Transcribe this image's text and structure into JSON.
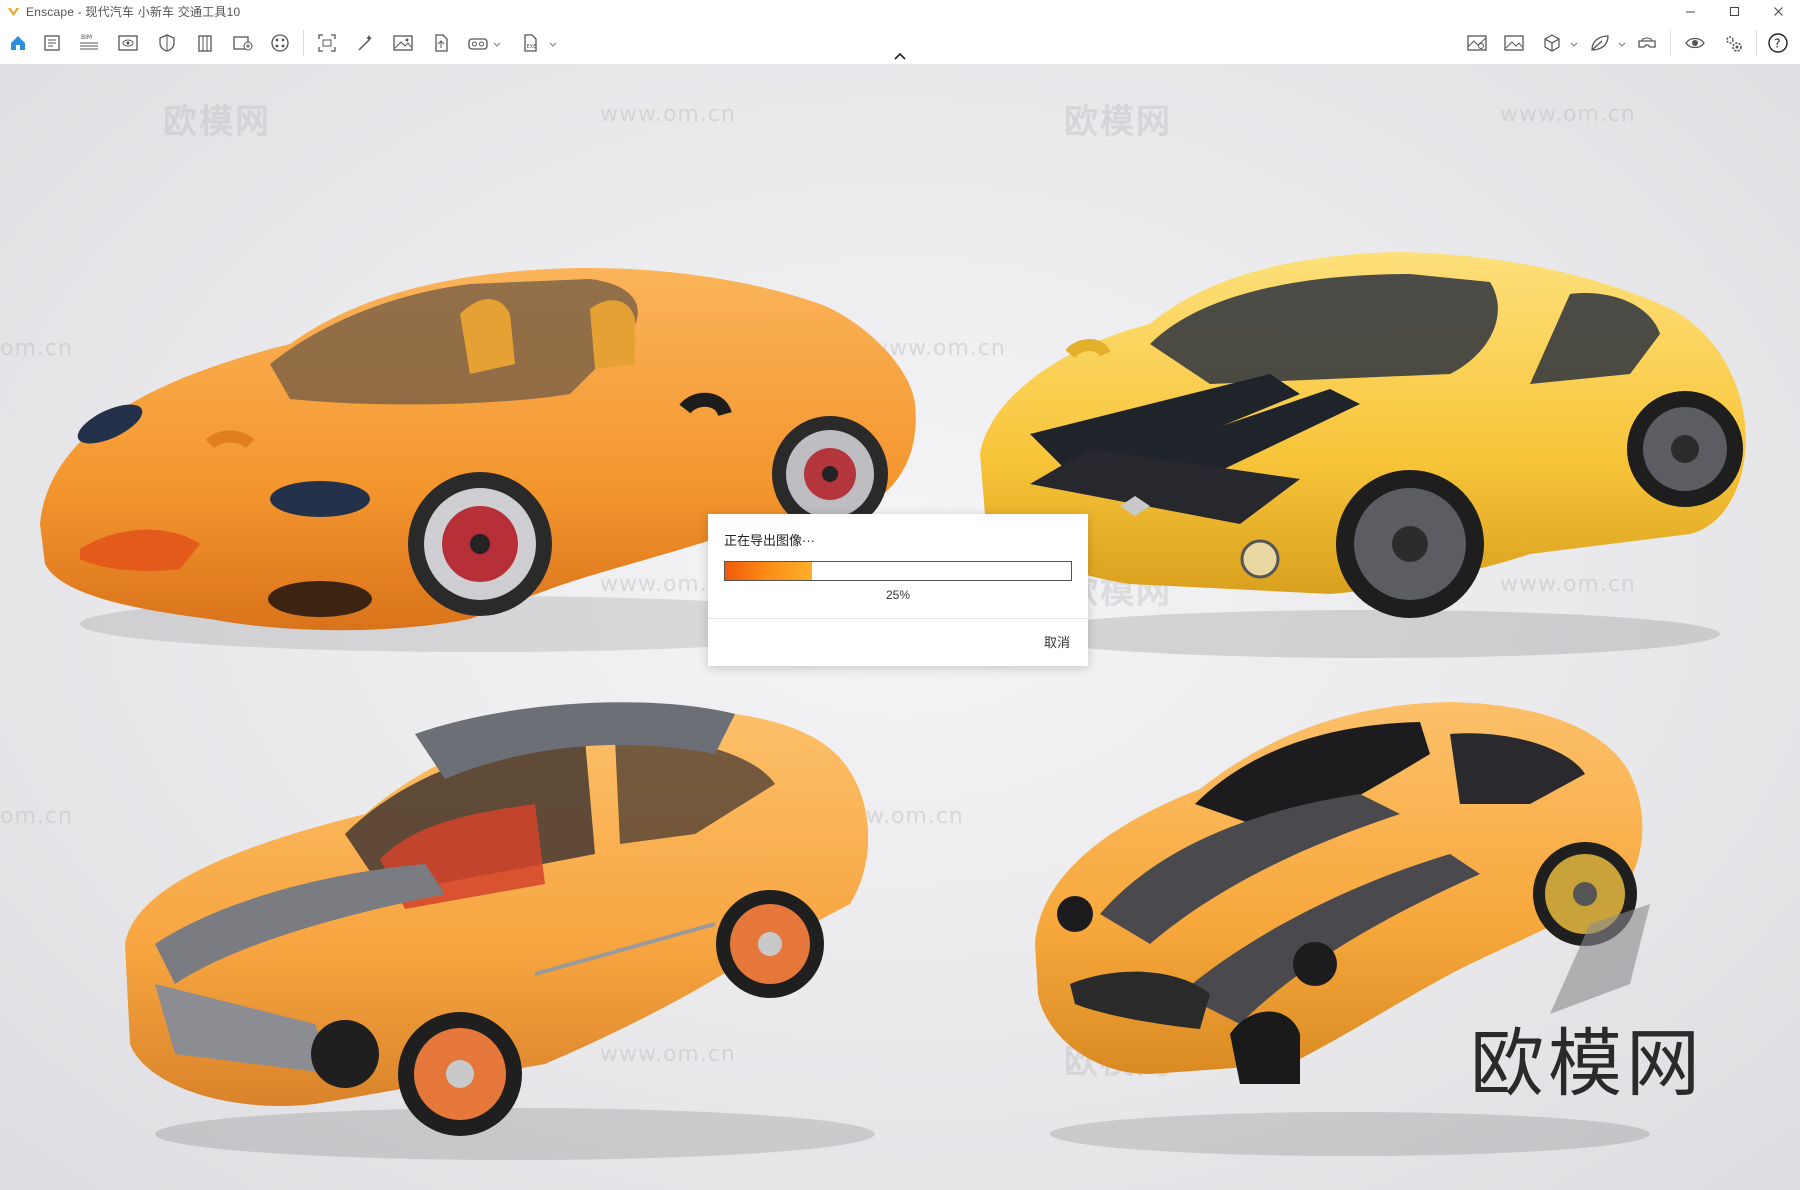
{
  "window": {
    "title": "Enscape - 现代汽车 小新车 交通工具10",
    "controls": [
      "minimize",
      "maximize",
      "close"
    ]
  },
  "toolbar": {
    "left_icons": [
      "home-icon",
      "document-icon",
      "bim-icon",
      "eye-view-icon",
      "shield-icon",
      "building-icon",
      "add-view-icon",
      "palette-icon",
      "screenshot-icon",
      "edit-magic-icon",
      "image-icon",
      "upload-icon",
      "vr-headset-icon",
      "export-icon"
    ],
    "right_icons": [
      "map-icon",
      "gallery-icon",
      "cube-icon",
      "leaf-icon",
      "vr-icon",
      "visibility-icon",
      "settings-icon",
      "help-icon"
    ],
    "bim_label": "BIM"
  },
  "watermarks": {
    "logo_text": "欧模网",
    "url_text": "www.om.cn",
    "partial_url": "om.cn",
    "big_text": "欧模网"
  },
  "dialog": {
    "title": "正在导出图像···",
    "progress_label": "25%",
    "progress_fraction": 0.25,
    "cancel_label": "取消"
  },
  "colors": {
    "accent": "#2e8fdc",
    "progress_start": "#f05a0a",
    "progress_end": "#fdb02a",
    "car_orange": "#f7a23c",
    "car_yellow": "#f9c73a"
  }
}
